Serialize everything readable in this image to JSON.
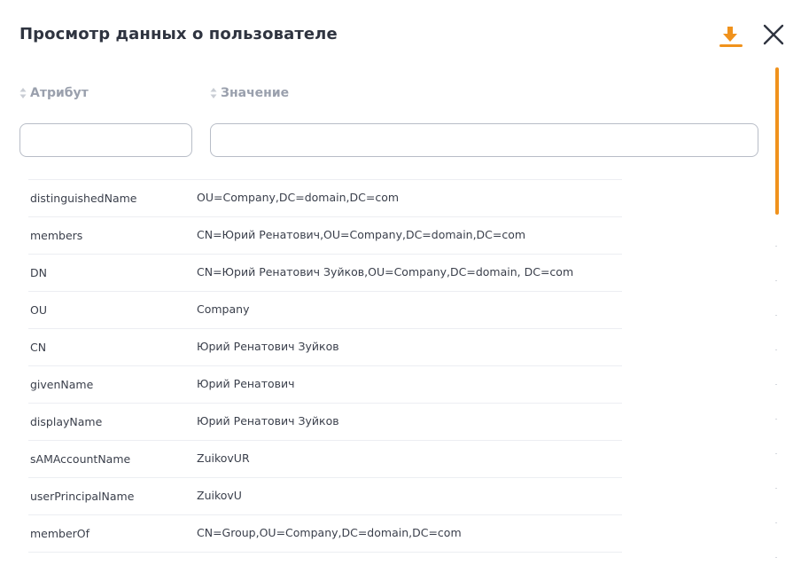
{
  "dialog": {
    "title": "Просмотр данных о пользователе"
  },
  "table": {
    "columns": {
      "attribute": "Атрибут",
      "value": "Значение"
    },
    "filters": {
      "attribute_value": "",
      "value_value": ""
    },
    "rows": [
      {
        "attribute": "distinguishedName",
        "value": "OU=Company,DC=domain,DC=com"
      },
      {
        "attribute": "members",
        "value": "CN=Юрий Ренатович,OU=Company,DC=domain,DC=com"
      },
      {
        "attribute": "DN",
        "value": "CN=Юрий Ренатович Зуйков,OU=Company,DC=domain, DC=com"
      },
      {
        "attribute": "OU",
        "value": "Company"
      },
      {
        "attribute": "CN",
        "value": "Юрий Ренатович Зуйков"
      },
      {
        "attribute": "givenName",
        "value": "Юрий Ренатович"
      },
      {
        "attribute": "displayName",
        "value": "Юрий Ренатович Зуйков"
      },
      {
        "attribute": "sAMAccountName",
        "value": "ZuikovUR"
      },
      {
        "attribute": "userPrincipalName",
        "value": "ZuikovU"
      },
      {
        "attribute": "memberOf",
        "value": "CN=Group,OU=Company,DC=domain,DC=com"
      }
    ]
  },
  "icons": {
    "download": "download-icon",
    "close": "close-icon",
    "sort": "sort-icon"
  },
  "colors": {
    "accent": "#f0921c",
    "text": "#2f3440",
    "muted": "#9aa0ad",
    "border": "#b8bdc7"
  }
}
